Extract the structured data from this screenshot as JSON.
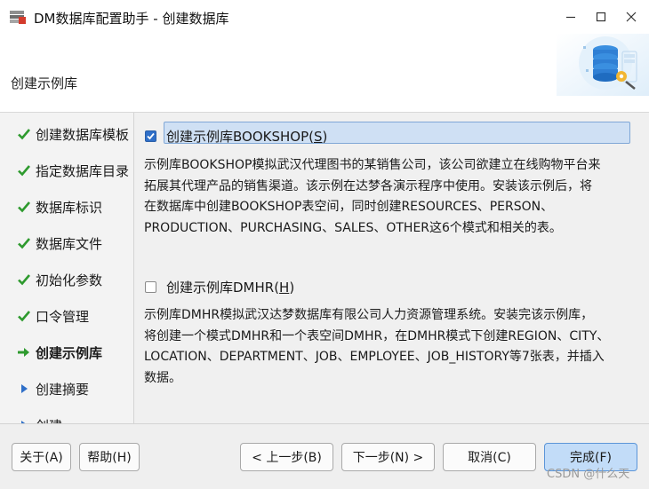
{
  "window": {
    "title": "DM数据库配置助手 - 创建数据库",
    "icon": "dm-app-icon"
  },
  "header": {
    "page_title": "创建示例库",
    "logo_icon": "database-settings-icon"
  },
  "steps": [
    {
      "label": "创建数据库模板",
      "state": "done"
    },
    {
      "label": "指定数据库目录",
      "state": "done"
    },
    {
      "label": "数据库标识",
      "state": "done"
    },
    {
      "label": "数据库文件",
      "state": "done"
    },
    {
      "label": "初始化参数",
      "state": "done"
    },
    {
      "label": "口令管理",
      "state": "done"
    },
    {
      "label": "创建示例库",
      "state": "current"
    },
    {
      "label": "创建摘要",
      "state": "pending"
    },
    {
      "label": "创建",
      "state": "pending"
    }
  ],
  "options": {
    "bookshop": {
      "label_prefix": "创建示例库BOOKSHOP(",
      "mnemonic": "S",
      "label_suffix": ")",
      "checked": true,
      "desc_lines": [
        "示例库BOOKSHOP模拟武汉代理图书的某销售公司，该公司欲建立在线购物平台来",
        "拓展其代理产品的销售渠道。该示例在达梦各演示程序中使用。安装该示例后，将",
        "在数据库中创建BOOKSHOP表空间，同时创建RESOURCES、PERSON、",
        "PRODUCTION、PURCHASING、SALES、OTHER这6个模式和相关的表。"
      ]
    },
    "dmhr": {
      "label_prefix": "创建示例库DMHR(",
      "mnemonic": "H",
      "label_suffix": ")",
      "checked": false,
      "desc_lines": [
        "示例库DMHR模拟武汉达梦数据库有限公司人力资源管理系统。安装完该示例库，",
        "将创建一个模式DMHR和一个表空间DMHR，在DMHR模式下创建REGION、CITY、",
        "LOCATION、DEPARTMENT、JOB、EMPLOYEE、JOB_HISTORY等7张表，并插入",
        "数据。"
      ]
    }
  },
  "footer": {
    "about": "关于(A)",
    "help": "帮助(H)",
    "prev": "< 上一步(B)",
    "next": "下一步(N) >",
    "cancel": "取消(C)",
    "finish": "完成(F)"
  },
  "watermark": "CSDN @什么天",
  "colors": {
    "check_green": "#2e9a2e",
    "arrow_green": "#2e9a2e",
    "pending_blue": "#2f6fc8",
    "primary_button": "#c2dcf8"
  }
}
